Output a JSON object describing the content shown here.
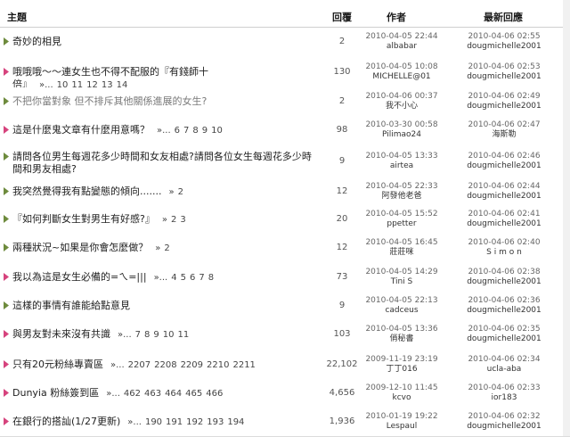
{
  "header": {
    "topic": "主題",
    "replies": "回覆",
    "author": "作者",
    "last_reply": "最新回應"
  },
  "rows": [
    {
      "title": "奇妙的相見",
      "pages": [],
      "replies": "2",
      "author_date": "2010-04-05 22:44",
      "author": "albabar",
      "last_date": "2010-04-06 02:55",
      "last_user": "dougmichelle2001",
      "arrow": "green",
      "grey": false
    },
    {
      "title": "哦哦哦～～連女生也不得不配服的『有錢師十倍』",
      "pages": [
        "»...",
        "10",
        "11",
        "12",
        "13",
        "14"
      ],
      "replies": "130",
      "author_date": "2010-04-05 10:08",
      "author": "MICHELLE@01",
      "last_date": "2010-04-06 02:53",
      "last_user": "dougmichelle2001",
      "arrow": "pink",
      "grey": false
    },
    {
      "title": "不把你當對象 但不排斥其他關係進展的女生?",
      "pages": [],
      "replies": "2",
      "author_date": "2010-04-06 00:37",
      "author": "我不小心",
      "last_date": "2010-04-06 02:49",
      "last_user": "dougmichelle2001",
      "arrow": "green",
      "grey": true
    },
    {
      "title": "這是什麼鬼文章有什麼用意嗎？",
      "pages": [
        "»...",
        "6",
        "7",
        "8",
        "9",
        "10"
      ],
      "replies": "98",
      "author_date": "2010-03-30 00:58",
      "author": "Pilimao24",
      "last_date": "2010-04-06 02:47",
      "last_user": "海斯勒",
      "arrow": "pink",
      "grey": false
    },
    {
      "title": "請問各位男生每週花多少時間和女友相處?請問各位女生每週花多少時間和男友相處?",
      "pages": [],
      "replies": "9",
      "author_date": "2010-04-05 13:33",
      "author": "airtea",
      "last_date": "2010-04-06 02:46",
      "last_user": "dougmichelle2001",
      "arrow": "green",
      "grey": false
    },
    {
      "title": "我突然覺得我有點變態的傾向.......",
      "pages": [
        "»",
        "2"
      ],
      "replies": "12",
      "author_date": "2010-04-05 22:33",
      "author": "阿發他老爸",
      "last_date": "2010-04-06 02:44",
      "last_user": "dougmichelle2001",
      "arrow": "green",
      "grey": false
    },
    {
      "title": "『如何判斷女生對男生有好感?』",
      "pages": [
        "»",
        "2",
        "3"
      ],
      "replies": "20",
      "author_date": "2010-04-05 15:52",
      "author": "ppetter",
      "last_date": "2010-04-06 02:41",
      "last_user": "dougmichelle2001",
      "arrow": "green",
      "grey": false
    },
    {
      "title": "兩種狀況~如果是你會怎麼做？",
      "pages": [
        "»",
        "2"
      ],
      "replies": "12",
      "author_date": "2010-04-05 16:45",
      "author": "莊莊咪",
      "last_date": "2010-04-06 02:40",
      "last_user": "S i m o n",
      "arrow": "green",
      "grey": false
    },
    {
      "title": "我以為這是女生必備的=ㄟ=|||",
      "pages": [
        "»...",
        "4",
        "5",
        "6",
        "7",
        "8"
      ],
      "replies": "73",
      "author_date": "2010-04-05 14:29",
      "author": "Tini S",
      "last_date": "2010-04-06 02:38",
      "last_user": "dougmichelle2001",
      "arrow": "pink",
      "grey": false
    },
    {
      "title": "這樣的事情有誰能給點意見",
      "pages": [],
      "replies": "9",
      "author_date": "2010-04-05 22:13",
      "author": "cadceus",
      "last_date": "2010-04-06 02:36",
      "last_user": "dougmichelle2001",
      "arrow": "green",
      "grey": false
    },
    {
      "title": "與男友對未來沒有共識",
      "pages": [
        "»...",
        "7",
        "8",
        "9",
        "10",
        "11"
      ],
      "replies": "103",
      "author_date": "2010-04-05 13:36",
      "author": "俏秘書",
      "last_date": "2010-04-06 02:35",
      "last_user": "dougmichelle2001",
      "arrow": "pink",
      "grey": false
    },
    {
      "title": "只有20元粉絲專賣區",
      "pages": [
        "»...",
        "2207",
        "2208",
        "2209",
        "2210",
        "2211"
      ],
      "replies": "22,102",
      "author_date": "2009-11-19 23:19",
      "author": "丁丁016",
      "last_date": "2010-04-06 02:34",
      "last_user": "ucla-aba",
      "arrow": "pink",
      "grey": false
    },
    {
      "title": "Dunyia 粉絲簽到區",
      "pages": [
        "»...",
        "462",
        "463",
        "464",
        "465",
        "466"
      ],
      "replies": "4,656",
      "author_date": "2009-12-10 11:45",
      "author": "kcvo",
      "last_date": "2010-04-06 02:33",
      "last_user": "ior183",
      "arrow": "pink",
      "grey": false
    },
    {
      "title": "在銀行的搭訕(1/27更新)",
      "pages": [
        "»...",
        "190",
        "191",
        "192",
        "193",
        "194"
      ],
      "replies": "1,936",
      "author_date": "2010-01-19 19:22",
      "author": "Lespaul",
      "last_date": "2010-04-06 02:32",
      "last_user": "dougmichelle2001",
      "arrow": "pink",
      "grey": false
    }
  ]
}
